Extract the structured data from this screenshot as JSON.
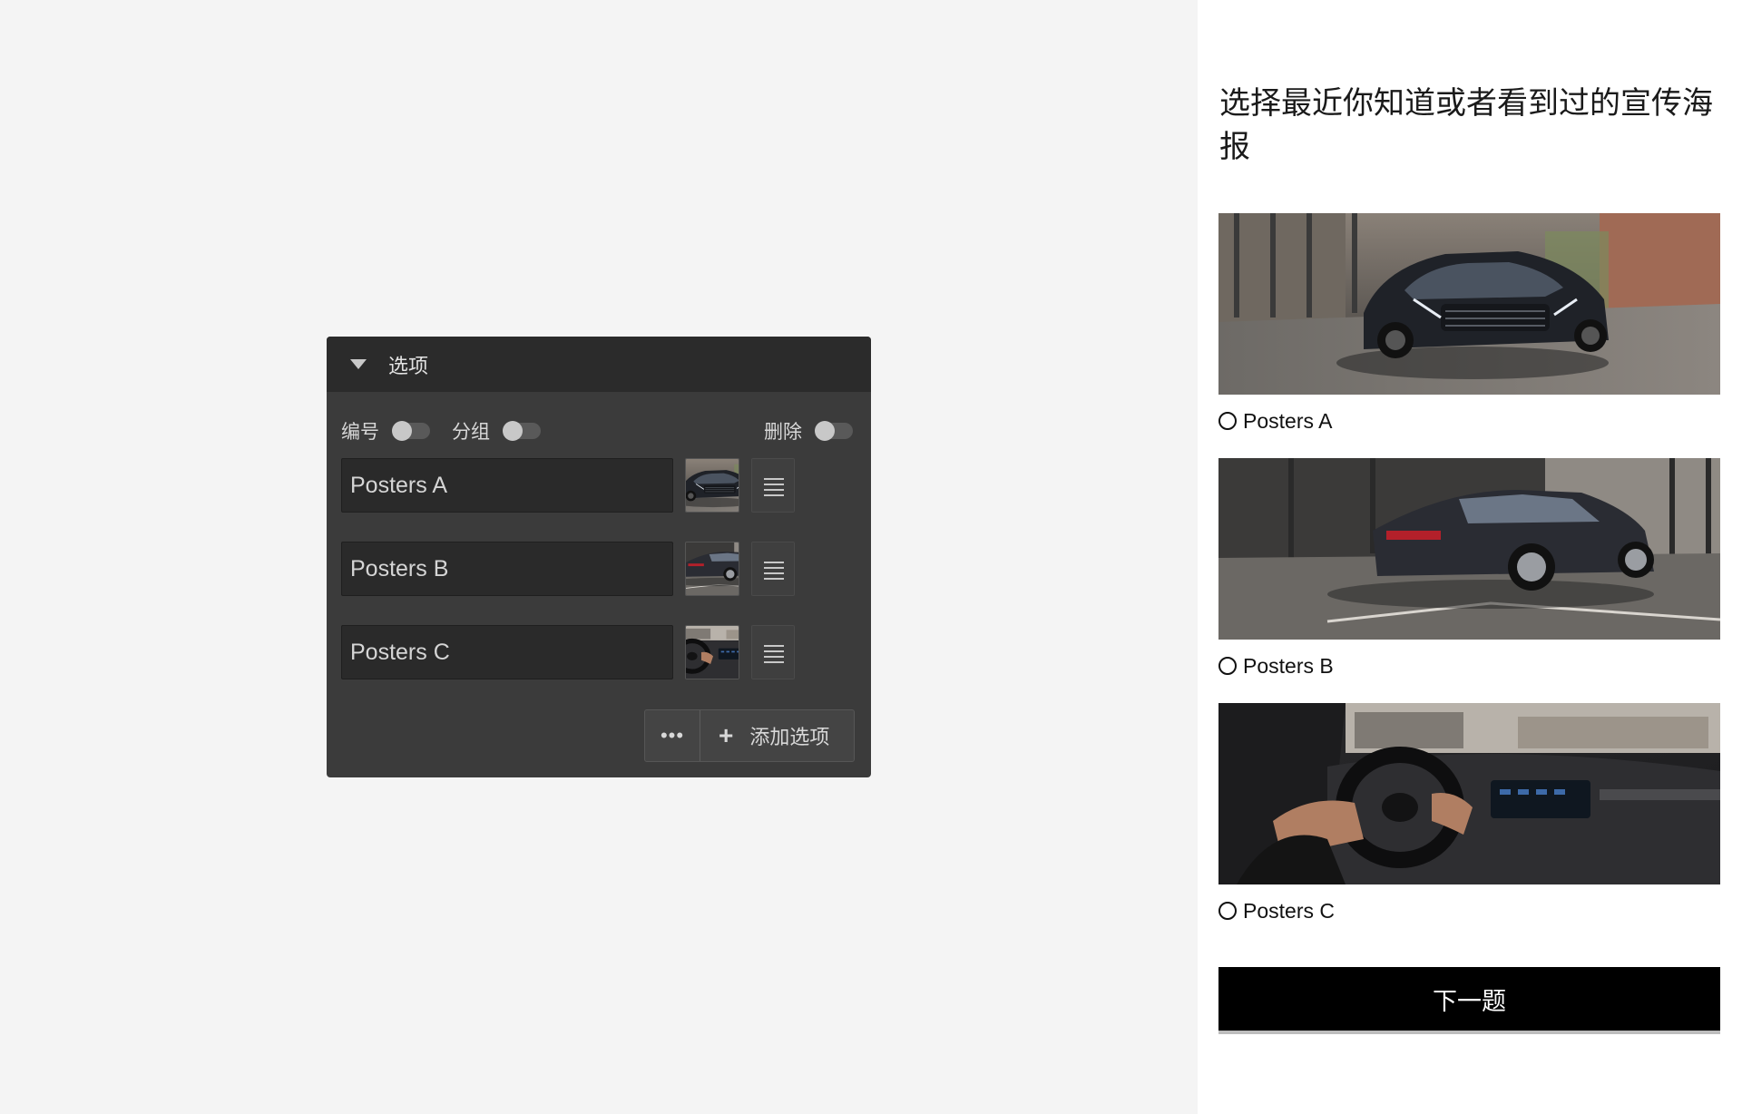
{
  "editor": {
    "header_title": "选项",
    "toggles": [
      {
        "label": "编号",
        "on": false
      },
      {
        "label": "分组",
        "on": false
      },
      {
        "label": "删除",
        "on": false
      }
    ],
    "options": [
      {
        "label": "Posters A",
        "thumb": "car-front-photo"
      },
      {
        "label": "Posters B",
        "thumb": "car-rear-photo"
      },
      {
        "label": "Posters C",
        "thumb": "car-interior-photo"
      }
    ],
    "more_label": "•••",
    "add_icon": "+",
    "add_label": "添加选项"
  },
  "preview": {
    "question": "选择最近你知道或者看到过的宣传海报",
    "choices": [
      {
        "label": "Posters A",
        "image": "car-front-photo"
      },
      {
        "label": "Posters B",
        "image": "car-rear-photo"
      },
      {
        "label": "Posters C",
        "image": "car-interior-photo"
      }
    ],
    "next_label": "下一题"
  },
  "colors": {
    "page_bg": "#f4f4f4",
    "panel_bg": "#3b3b3b",
    "panel_header_bg": "#2b2b2b",
    "next_button_bg": "#000000"
  }
}
